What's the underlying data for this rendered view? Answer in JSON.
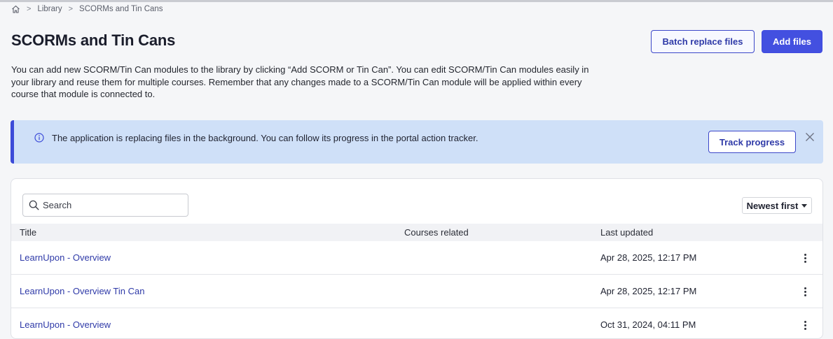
{
  "breadcrumb": {
    "items": [
      {
        "label": "Library"
      },
      {
        "label": "SCORMs and Tin Cans"
      }
    ]
  },
  "header": {
    "title": "SCORMs and Tin Cans",
    "batch_replace_label": "Batch replace files",
    "add_files_label": "Add files"
  },
  "description": "You can add new SCORM/Tin Can modules to the library by clicking “Add SCORM or Tin Can”. You can edit SCORM/Tin Can modules easily in your library and reuse them for multiple courses. Remember that any changes made to a SCORM/Tin Can module will be applied within every course that module is connected to.",
  "banner": {
    "message": "The application is replacing files in the background. You can follow its progress in the portal action tracker.",
    "track_label": "Track progress",
    "icon": "info-icon",
    "accent_color": "#3c4bd8"
  },
  "toolbar": {
    "search_placeholder": "Search",
    "sort_label": "Newest first"
  },
  "table": {
    "columns": {
      "title": "Title",
      "courses_related": "Courses related",
      "last_updated": "Last updated"
    },
    "rows": [
      {
        "title": "LearnUpon - Overview",
        "courses_related": "",
        "last_updated": "Apr 28, 2025, 12:17 PM"
      },
      {
        "title": "LearnUpon - Overview Tin Can",
        "courses_related": "",
        "last_updated": "Apr 28, 2025, 12:17 PM"
      },
      {
        "title": "LearnUpon - Overview",
        "courses_related": "",
        "last_updated": "Oct 31, 2024, 04:11 PM"
      }
    ]
  },
  "colors": {
    "primary": "#4350e0",
    "link": "#2f3aa8",
    "banner_bg": "#cfe0f8"
  }
}
